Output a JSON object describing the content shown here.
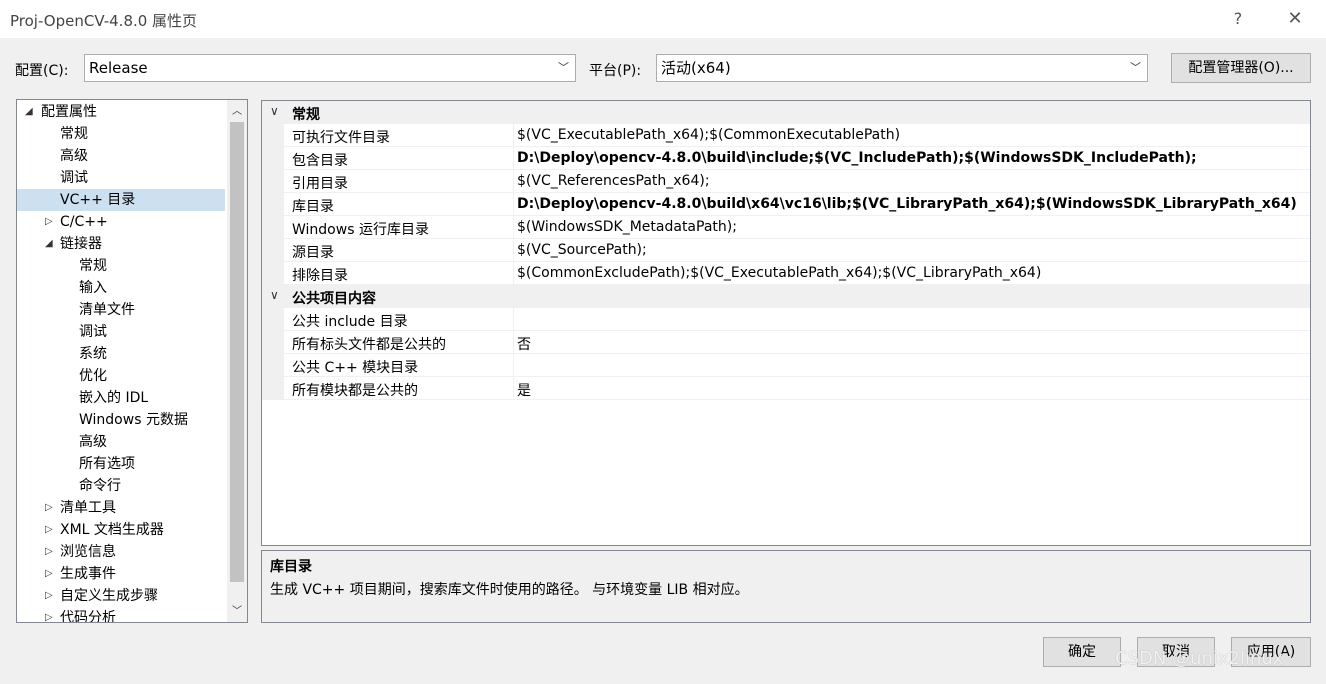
{
  "window": {
    "title": "Proj-OpenCV-4.8.0 属性页",
    "help_label": "?",
    "close_label": "✕"
  },
  "config": {
    "config_label": "配置(C):",
    "config_value": "Release",
    "platform_label": "平台(P):",
    "platform_value": "活动(x64)",
    "manager_label": "配置管理器(O)..."
  },
  "tree": {
    "items": [
      {
        "label": "配置属性",
        "toggle": "◢"
      },
      {
        "label": "常规"
      },
      {
        "label": "高级"
      },
      {
        "label": "调试"
      },
      {
        "label": "VC++ 目录"
      },
      {
        "label": "C/C++",
        "toggle": "▷"
      },
      {
        "label": "链接器",
        "toggle": "◢"
      },
      {
        "label": "常规"
      },
      {
        "label": "输入"
      },
      {
        "label": "清单文件"
      },
      {
        "label": "调试"
      },
      {
        "label": "系统"
      },
      {
        "label": "优化"
      },
      {
        "label": "嵌入的 IDL"
      },
      {
        "label": "Windows 元数据"
      },
      {
        "label": "高级"
      },
      {
        "label": "所有选项"
      },
      {
        "label": "命令行"
      },
      {
        "label": "清单工具",
        "toggle": "▷"
      },
      {
        "label": "XML 文档生成器",
        "toggle": "▷"
      },
      {
        "label": "浏览信息",
        "toggle": "▷"
      },
      {
        "label": "生成事件",
        "toggle": "▷"
      },
      {
        "label": "自定义生成步骤",
        "toggle": "▷"
      },
      {
        "label": "代码分析",
        "toggle": "▷"
      }
    ],
    "selected_index": 4
  },
  "grid": {
    "categories": [
      {
        "label": "常规",
        "rows": [
          {
            "name": "可执行文件目录",
            "value": "$(VC_ExecutablePath_x64);$(CommonExecutablePath)",
            "bold": false
          },
          {
            "name": "包含目录",
            "value": "D:\\Deploy\\opencv-4.8.0\\build\\include;$(VC_IncludePath);$(WindowsSDK_IncludePath);",
            "bold": true
          },
          {
            "name": "引用目录",
            "value": "$(VC_ReferencesPath_x64);",
            "bold": false
          },
          {
            "name": "库目录",
            "value": "D:\\Deploy\\opencv-4.8.0\\build\\x64\\vc16\\lib;$(VC_LibraryPath_x64);$(WindowsSDK_LibraryPath_x64)",
            "bold": true
          },
          {
            "name": "Windows 运行库目录",
            "value": "$(WindowsSDK_MetadataPath);",
            "bold": false
          },
          {
            "name": "源目录",
            "value": "$(VC_SourcePath);",
            "bold": false
          },
          {
            "name": "排除目录",
            "value": "$(CommonExcludePath);$(VC_ExecutablePath_x64);$(VC_LibraryPath_x64)",
            "bold": false
          }
        ]
      },
      {
        "label": "公共项目内容",
        "rows": [
          {
            "name": "公共 include 目录",
            "value": "",
            "bold": false
          },
          {
            "name": "所有标头文件都是公共的",
            "value": "否",
            "bold": false
          },
          {
            "name": "公共 C++ 模块目录",
            "value": "",
            "bold": false
          },
          {
            "name": "所有模块都是公共的",
            "value": "是",
            "bold": false
          }
        ]
      }
    ]
  },
  "description": {
    "title": "库目录",
    "text": "生成 VC++ 项目期间，搜索库文件时使用的路径。 与环境变量 LIB 相对应。"
  },
  "buttons": {
    "ok": "确定",
    "cancel": "取消",
    "apply": "应用(A)"
  },
  "watermark": "CSDN @unix2linux"
}
